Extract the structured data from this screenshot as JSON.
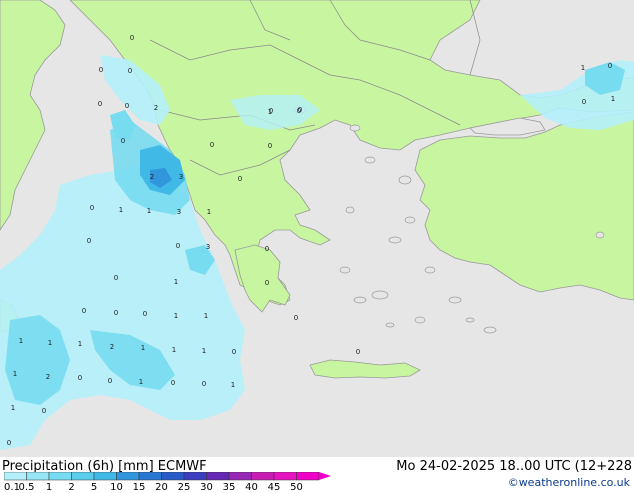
{
  "legend": {
    "title": "Precipitation (6h) [mm] ECMWF",
    "run_info": "Mo 24-02-2025 18..00 UTC (12+228",
    "credit": "©weatheronline.co.uk",
    "ticks": [
      "0.1",
      "0.5",
      "1",
      "2",
      "5",
      "10",
      "15",
      "20",
      "25",
      "30",
      "35",
      "40",
      "45",
      "50"
    ],
    "colors": [
      "#b4f0fa",
      "#96e6f5",
      "#78dcf0",
      "#5acdeb",
      "#41b9e6",
      "#3296dc",
      "#2878d2",
      "#285ac8",
      "#3c3cbe",
      "#6428b4",
      "#9628b4",
      "#c81eb4",
      "#e614be",
      "#f000c8"
    ]
  },
  "colors": {
    "land": "#c8f5a0",
    "sea": "#e6e6e6",
    "coast": "#9a9a9a",
    "border": "#8a8a8a"
  },
  "values": [
    {
      "text": "0"
    },
    {
      "text": "0"
    },
    {
      "text": "0"
    },
    {
      "text": "0"
    },
    {
      "text": "0"
    },
    {
      "text": "2"
    },
    {
      "text": "0"
    },
    {
      "text": "0"
    },
    {
      "text": "0"
    },
    {
      "text": "1"
    },
    {
      "text": "0"
    },
    {
      "text": "0"
    },
    {
      "text": "2"
    },
    {
      "text": "3"
    },
    {
      "text": "0"
    },
    {
      "text": "0"
    },
    {
      "text": "1"
    },
    {
      "text": "1"
    },
    {
      "text": "3"
    },
    {
      "text": "1"
    },
    {
      "text": "0"
    },
    {
      "text": "0"
    },
    {
      "text": "3"
    },
    {
      "text": "0"
    },
    {
      "text": "0"
    },
    {
      "text": "1"
    },
    {
      "text": "0"
    },
    {
      "text": "0"
    },
    {
      "text": "0"
    },
    {
      "text": "0"
    },
    {
      "text": "1"
    },
    {
      "text": "1"
    },
    {
      "text": "0"
    },
    {
      "text": "1"
    },
    {
      "text": "1"
    },
    {
      "text": "1"
    },
    {
      "text": "2"
    },
    {
      "text": "1"
    },
    {
      "text": "1"
    },
    {
      "text": "1"
    },
    {
      "text": "0"
    },
    {
      "text": "0"
    },
    {
      "text": "1"
    },
    {
      "text": "2"
    },
    {
      "text": "0"
    },
    {
      "text": "0"
    },
    {
      "text": "1"
    },
    {
      "text": "0"
    },
    {
      "text": "0"
    },
    {
      "text": "1"
    },
    {
      "text": "1"
    },
    {
      "text": "0"
    },
    {
      "text": "0"
    },
    {
      "text": "1"
    },
    {
      "text": "0"
    },
    {
      "text": "0"
    },
    {
      "text": "1"
    },
    {
      "text": "0"
    }
  ]
}
